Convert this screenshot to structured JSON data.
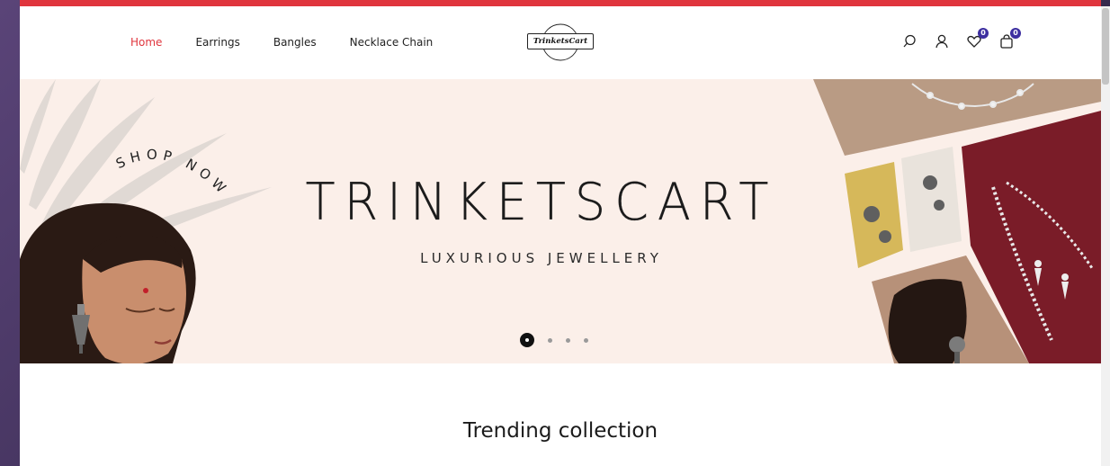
{
  "nav": {
    "items": [
      {
        "label": "Home",
        "active": true
      },
      {
        "label": "Earrings",
        "active": false
      },
      {
        "label": "Bangles",
        "active": false
      },
      {
        "label": "Necklace Chain",
        "active": false
      }
    ]
  },
  "logo": {
    "text": "TrinketsCart"
  },
  "header_icons": {
    "wishlist_count": "0",
    "cart_count": "0"
  },
  "banner": {
    "curved_text": "SHOP NOW",
    "title": "TRINKETSCART",
    "subtitle": "LUXURIOUS JEWELLERY",
    "slide_count": 4,
    "active_slide": 1
  },
  "section": {
    "title": "Trending collection"
  },
  "colors": {
    "accent": "#e0353d",
    "badge": "#3d2fa0",
    "banner_bg": "#fbefe9",
    "collage_red": "#7a1c28"
  }
}
